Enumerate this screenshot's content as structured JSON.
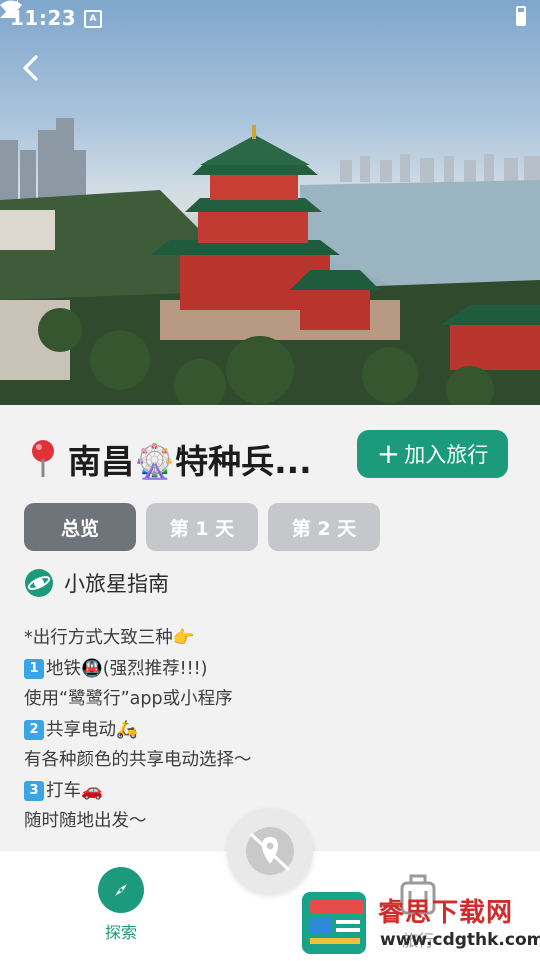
{
  "status_bar": {
    "time": "11:23",
    "notification_badge": "A"
  },
  "hero": {
    "image_subject": "pagoda-cityscape-photo"
  },
  "trip": {
    "pin_icon": "pin-icon",
    "title": "南昌🎡特种兵...",
    "add_button_label": "加入旅行"
  },
  "tabs": [
    {
      "label": "总览",
      "active": true
    },
    {
      "label": "第 1 天",
      "active": false
    },
    {
      "label": "第 2 天",
      "active": false
    }
  ],
  "guide": {
    "title": "小旅星指南",
    "lines": [
      {
        "prefix": "",
        "text": "*出行方式大致三种👉"
      },
      {
        "prefix": "1",
        "text": "地铁🚇(强烈推荐!!!)"
      },
      {
        "prefix": "",
        "text": "使用“鹭鹭行”app或小程序"
      },
      {
        "prefix": "2",
        "text": "共享电动🛵"
      },
      {
        "prefix": "",
        "text": "有各种颜色的共享电动选择～"
      },
      {
        "prefix": "3",
        "text": "打车🚗"
      },
      {
        "prefix": "",
        "text": "随时随地出发～"
      }
    ]
  },
  "nav": {
    "explore_label": "探索",
    "trip_label": "旅行",
    "map_icon": "map-location-icon"
  },
  "watermark": {
    "title": "睿思下载网",
    "url": "www.cdgthk.com"
  },
  "colors": {
    "accent": "#1b9a7c",
    "tab_active": "#6f737a",
    "tab_inactive": "#c6c7ca",
    "sheet_bg": "#f2f2f2"
  }
}
